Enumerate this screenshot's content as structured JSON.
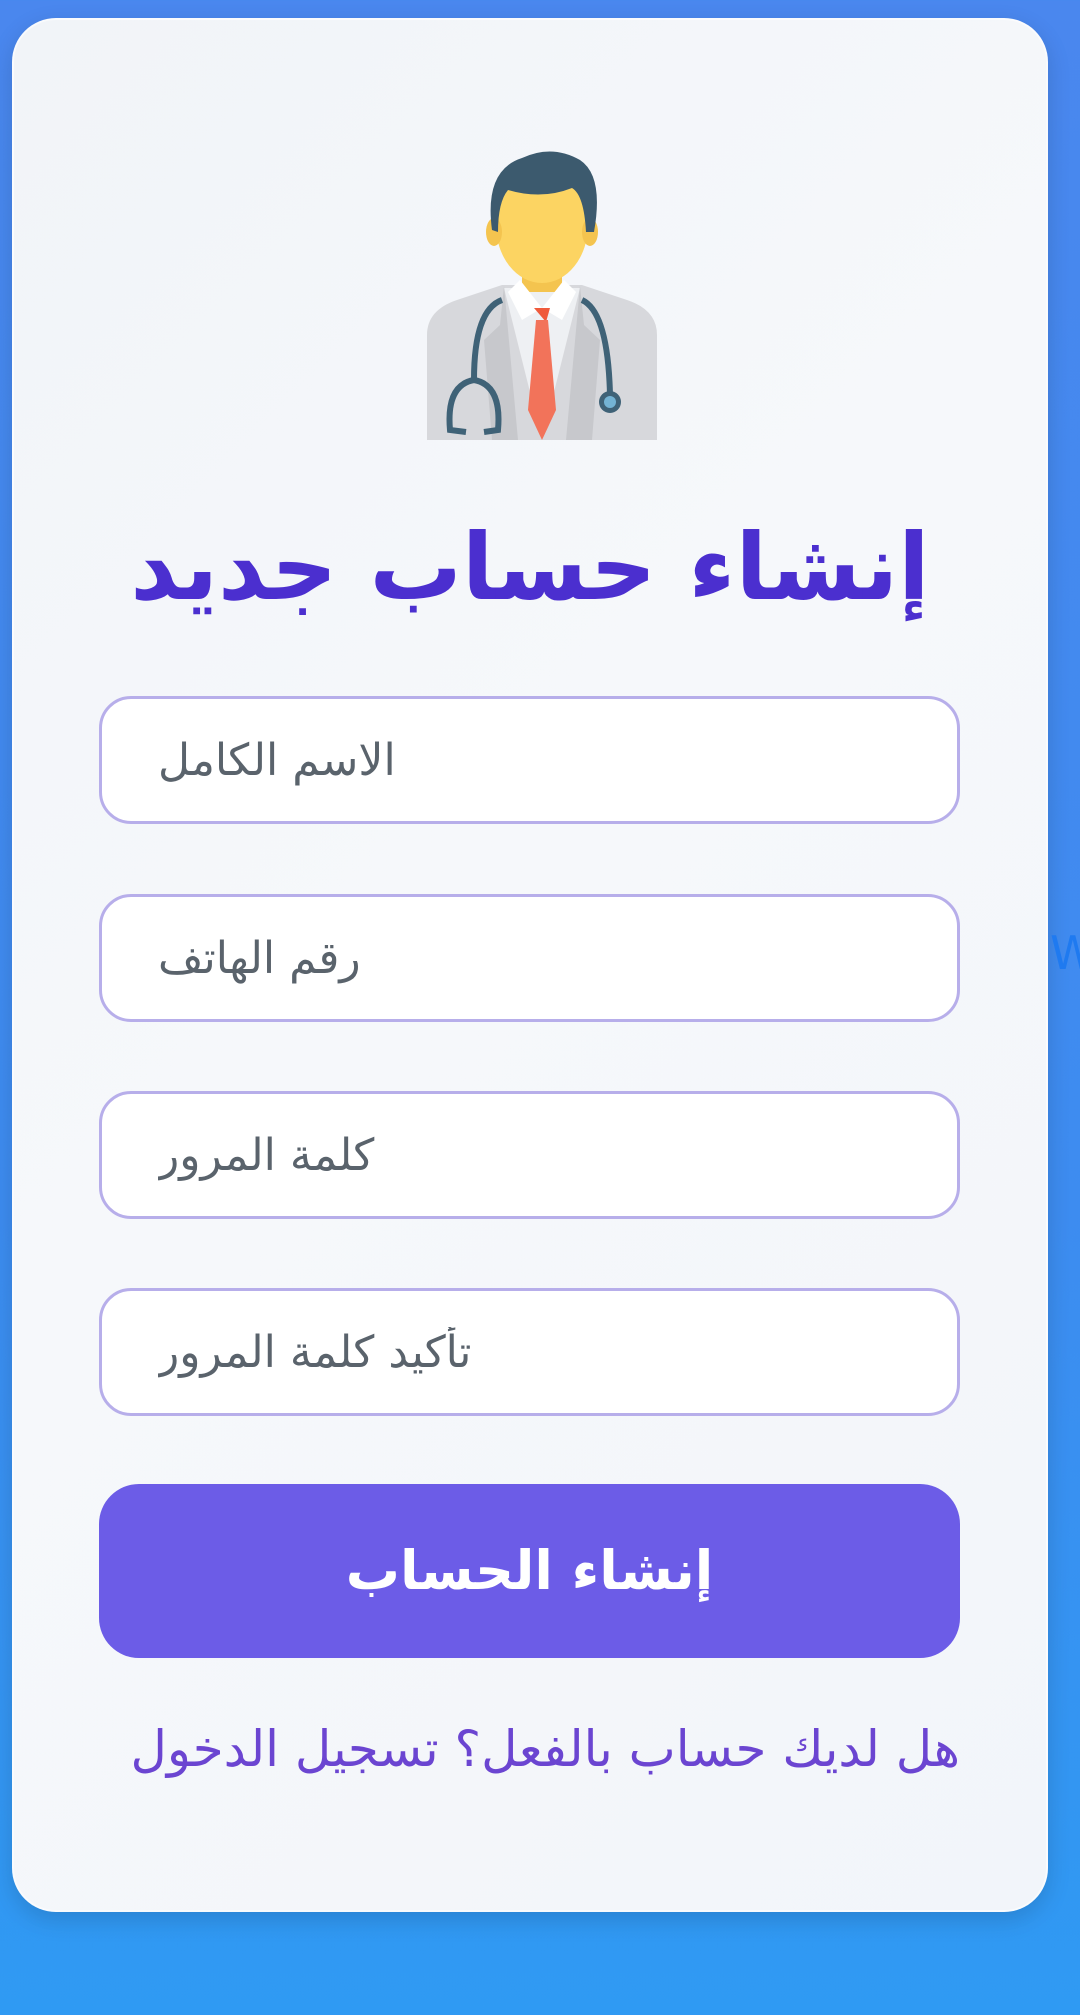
{
  "page": {
    "title": "إنشاء حساب جديد",
    "edge_fragment": "W",
    "avatar_icon": "doctor-avatar-icon"
  },
  "form": {
    "fields": [
      {
        "placeholder": "الاسم الكامل"
      },
      {
        "placeholder": "رقم الهاتف"
      },
      {
        "placeholder": "كلمة المرور"
      },
      {
        "placeholder": "تأكيد كلمة المرور"
      }
    ],
    "submit_label": "إنشاء الحساب"
  },
  "footer": {
    "question": "هل لديك حساب بالفعل؟",
    "login_link": "تسجيل الدخول"
  },
  "colors": {
    "background_top": "#4a87ee",
    "background_bottom": "#2f9af3",
    "card": "#f3f6fa",
    "title": "#4b2fcf",
    "input_border": "#b7aeea",
    "button": "#6c5ce7",
    "link": "#6b45d1"
  }
}
